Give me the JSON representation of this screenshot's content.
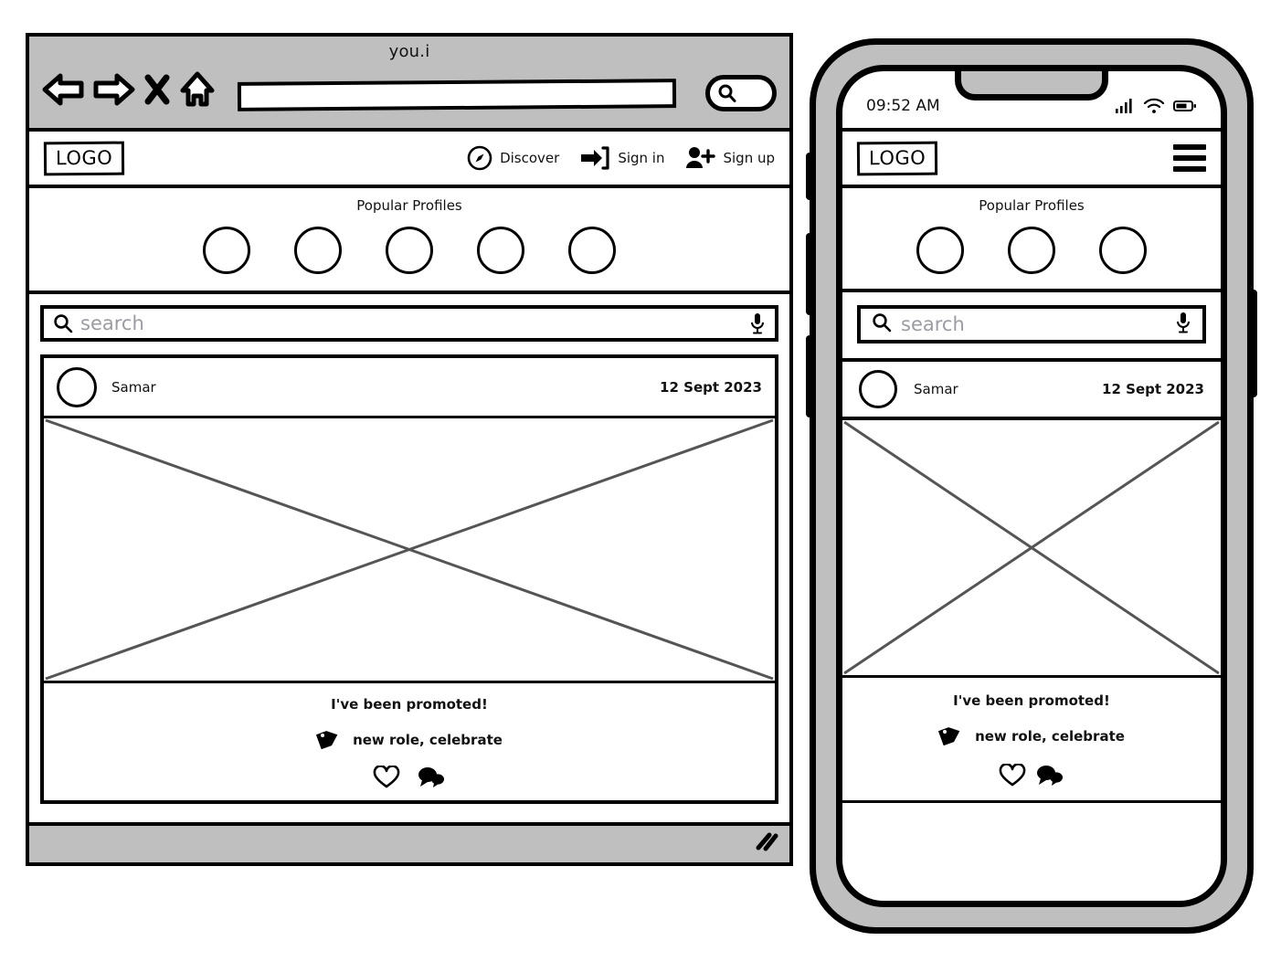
{
  "browser": {
    "window_title": "you.i",
    "toolbar": {
      "back_icon": "back-arrow-icon",
      "forward_icon": "forward-arrow-icon",
      "stop_icon": "close-x-icon",
      "home_icon": "home-icon",
      "address_value": "",
      "address_placeholder": "",
      "go_icon": "search-icon"
    },
    "footer": {
      "resize_grip_icon": "resize-grip-icon"
    }
  },
  "site": {
    "logo": "LOGO",
    "nav": [
      {
        "label": "Discover",
        "icon": "compass-icon"
      },
      {
        "label": "Sign in",
        "icon": "sign-in-arrow-icon"
      },
      {
        "label": "Sign up",
        "icon": "person-add-icon"
      }
    ],
    "popular": {
      "title": "Popular Profiles",
      "avatar_count_desktop": 5,
      "avatar_count_mobile": 3
    },
    "search": {
      "placeholder": "search",
      "value": "",
      "leading_icon": "search-icon",
      "trailing_icon": "microphone-icon"
    },
    "post": {
      "author": "Samar",
      "date": "12 Sept 2023",
      "image_alt": "image-placeholder",
      "caption": "I've been promoted!",
      "tag_icon": "tag-icon",
      "tags": "new role, celebrate",
      "actions": [
        {
          "name": "like",
          "icon": "heart-icon"
        },
        {
          "name": "comment",
          "icon": "comment-bubbles-icon"
        }
      ]
    }
  },
  "phone": {
    "status": {
      "time": "09:52 AM",
      "signal_icon": "cellular-signal-icon",
      "wifi_icon": "wifi-icon",
      "battery_icon": "battery-icon"
    },
    "menu_icon": "hamburger-menu-icon",
    "buttons": {
      "silent": "silent-switch",
      "volume_up": "volume-up-button",
      "volume_down": "volume-down-button",
      "power": "power-button"
    }
  },
  "colors": {
    "chrome_gray": "#bfbfbf",
    "ink": "#000000",
    "placeholder_gray": "#9b9ba5",
    "image_x_gray": "#555555"
  }
}
